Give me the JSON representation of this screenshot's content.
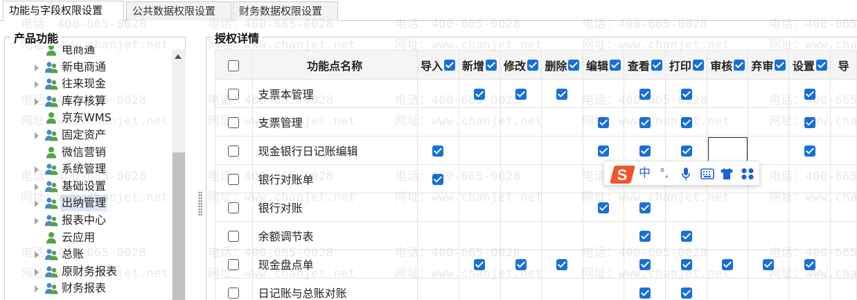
{
  "tabs": [
    {
      "label": "功能与字段权限设置",
      "active": true
    },
    {
      "label": "公共数据权限设置",
      "active": false
    },
    {
      "label": "财务数据权限设置",
      "active": false
    }
  ],
  "left_panel": {
    "title": "产品功能",
    "tree": [
      {
        "label": "电商通",
        "expandable": false,
        "icon": "single-user-icon"
      },
      {
        "label": "新电商通",
        "expandable": true,
        "icon": "user-group-icon"
      },
      {
        "label": "往来现金",
        "expandable": true,
        "icon": "user-group-icon"
      },
      {
        "label": "库存核算",
        "expandable": true,
        "icon": "user-group-icon"
      },
      {
        "label": "京东WMS",
        "expandable": false,
        "icon": "single-user-icon"
      },
      {
        "label": "固定资产",
        "expandable": true,
        "icon": "user-group-icon"
      },
      {
        "label": "微信营销",
        "expandable": false,
        "icon": "single-user-icon"
      },
      {
        "label": "系统管理",
        "expandable": true,
        "icon": "user-group-icon"
      },
      {
        "label": "基础设置",
        "expandable": true,
        "icon": "user-group-icon"
      },
      {
        "label": "出纳管理",
        "expandable": true,
        "icon": "user-group-icon",
        "selected": true
      },
      {
        "label": "报表中心",
        "expandable": true,
        "icon": "user-group-icon"
      },
      {
        "label": "云应用",
        "expandable": false,
        "icon": "single-user-icon"
      },
      {
        "label": "总账",
        "expandable": true,
        "icon": "user-group-icon"
      },
      {
        "label": "原财务报表",
        "expandable": true,
        "icon": "user-group-icon"
      },
      {
        "label": "财务报表",
        "expandable": true,
        "icon": "user-group-icon"
      }
    ]
  },
  "right_panel": {
    "title": "授权详情",
    "name_header": "功能点名称",
    "columns": [
      "导入",
      "新增",
      "修改",
      "删除",
      "编辑",
      "查看",
      "打印",
      "审核",
      "弃审",
      "设置",
      "导"
    ],
    "rows": [
      {
        "name": "支票本管理",
        "checks": [
          false,
          true,
          true,
          true,
          false,
          true,
          true,
          false,
          false,
          true,
          false
        ]
      },
      {
        "name": "支票管理",
        "checks": [
          false,
          false,
          false,
          false,
          true,
          true,
          true,
          false,
          false,
          true,
          false
        ]
      },
      {
        "name": "现金银行日记账编辑",
        "checks": [
          true,
          false,
          false,
          false,
          true,
          true,
          true,
          false,
          false,
          true,
          false
        ]
      },
      {
        "name": "银行对账单",
        "checks": [
          true,
          false,
          false,
          false,
          false,
          false,
          false,
          false,
          false,
          false,
          false
        ]
      },
      {
        "name": "银行对账",
        "checks": [
          false,
          false,
          false,
          false,
          true,
          true,
          false,
          false,
          false,
          false,
          false
        ]
      },
      {
        "name": "余额调节表",
        "checks": [
          false,
          false,
          false,
          false,
          false,
          true,
          true,
          false,
          false,
          false,
          false
        ]
      },
      {
        "name": "现金盘点单",
        "checks": [
          false,
          true,
          true,
          true,
          false,
          true,
          true,
          true,
          true,
          true,
          false
        ]
      },
      {
        "name": "日记账与总账对账",
        "checks": [
          false,
          false,
          false,
          false,
          false,
          true,
          true,
          false,
          false,
          false,
          false
        ]
      }
    ]
  },
  "ime_toolbar": {
    "logo_letter": "S",
    "lang": "中",
    "punct": "°,",
    "colors": {
      "brand": "#f0562a",
      "icon": "#1b63d4"
    }
  },
  "watermark": {
    "phone": "电话：400-665-0028",
    "site": "网址：www.chanjet.net"
  },
  "colors": {
    "checkbox": "#1670dc",
    "header_bg": "#f5f5f5",
    "selected_bg": "#dfe8f6"
  }
}
